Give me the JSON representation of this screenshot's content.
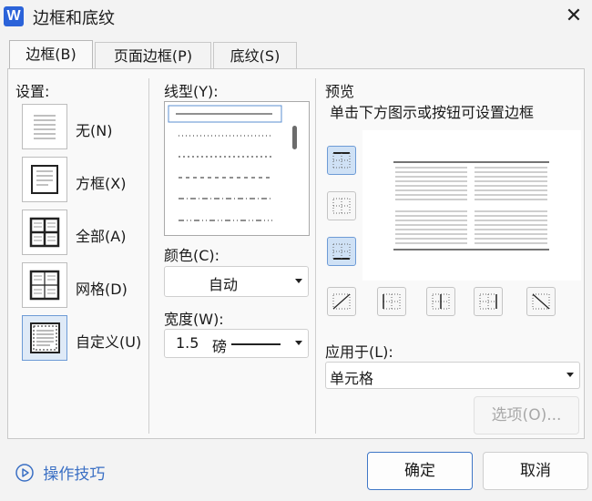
{
  "window": {
    "app_icon_letter": "W",
    "title": "边框和底纹"
  },
  "tabs": [
    {
      "label": "边框(B)",
      "active": true
    },
    {
      "label": "页面边框(P)",
      "active": false
    },
    {
      "label": "底纹(S)",
      "active": false
    }
  ],
  "settings": {
    "heading": "设置:",
    "items": [
      {
        "label": "无(N)",
        "icon": "border-none-icon"
      },
      {
        "label": "方框(X)",
        "icon": "border-box-icon"
      },
      {
        "label": "全部(A)",
        "icon": "border-all-icon"
      },
      {
        "label": "网格(D)",
        "icon": "border-grid-icon"
      },
      {
        "label": "自定义(U)",
        "icon": "border-custom-icon",
        "selected": true
      }
    ]
  },
  "line_style": {
    "heading": "线型(Y):"
  },
  "color": {
    "heading": "颜色(C):",
    "value": "自动"
  },
  "width": {
    "heading": "宽度(W):",
    "value": "1.5",
    "unit": "磅"
  },
  "preview": {
    "heading": "预览",
    "hint": "单击下方图示或按钮可设置边框"
  },
  "apply_to": {
    "heading": "应用于(L):",
    "value": "单元格"
  },
  "buttons": {
    "options": "选项(O)...",
    "ok": "确定",
    "cancel": "取消"
  },
  "tips": {
    "label": "操作技巧"
  },
  "colors": {
    "accent": "#3a6fc4",
    "selected_bg": "#dfeaf7",
    "app_icon": "#2b63d9"
  }
}
